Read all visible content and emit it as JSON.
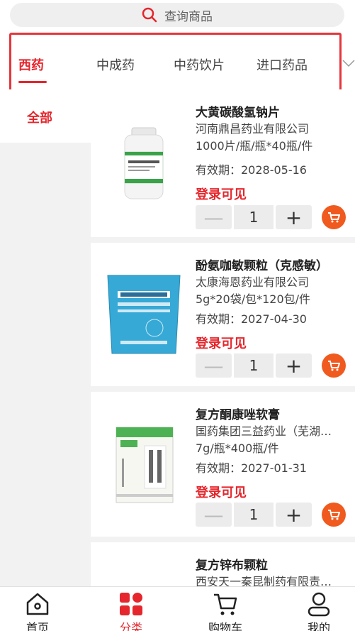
{
  "search": {
    "placeholder": "查询商品"
  },
  "tabs": [
    {
      "label": "西药",
      "active": true
    },
    {
      "label": "中成药",
      "active": false
    },
    {
      "label": "中药饮片",
      "active": false
    },
    {
      "label": "进口药品",
      "active": false
    }
  ],
  "left_categories": [
    {
      "label": "全部",
      "active": true
    }
  ],
  "products": [
    {
      "name": "大黄碳酸氢钠片",
      "maker": "河南鼎昌药业有限公司",
      "spec": "1000片/瓶/瓶*40瓶/件",
      "expiry": "有效期：2028-05-16",
      "price_text": "登录可见",
      "qty": "1",
      "image_icon": "white-pill-bottle"
    },
    {
      "name": "酚氨咖敏颗粒（克感敏）",
      "maker": "太康海恩药业有限公司",
      "spec": "5g*20袋/包*120包/件",
      "expiry": "有效期：2027-04-30",
      "price_text": "登录可见",
      "qty": "1",
      "image_icon": "blue-granule-bag"
    },
    {
      "name": "复方酮康唑软膏",
      "maker": "国药集团三益药业（芜湖…",
      "spec": "7g/瓶*400瓶/件",
      "expiry": "有效期：2027-01-31",
      "price_text": "登录可见",
      "qty": "1",
      "image_icon": "ointment-box"
    },
    {
      "name": "复方锌布颗粒",
      "maker": "西安天一秦昆制药有限责…",
      "spec": "",
      "expiry": "",
      "price_text": "",
      "qty": "",
      "image_icon": "granule-box"
    }
  ],
  "bottom_nav": [
    {
      "label": "首页",
      "icon": "home-icon",
      "active": false
    },
    {
      "label": "分类",
      "icon": "category-icon",
      "active": true
    },
    {
      "label": "购物车",
      "icon": "cart-icon",
      "active": false
    },
    {
      "label": "我的",
      "icon": "user-icon",
      "active": false
    }
  ],
  "colors": {
    "accent": "#e5262c",
    "cart": "#f05a1e",
    "highlight_border": "#e5353c"
  }
}
